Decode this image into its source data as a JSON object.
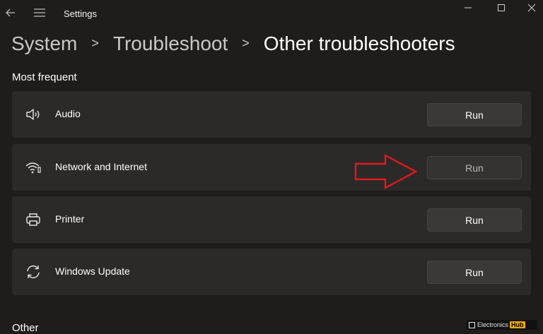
{
  "window": {
    "title": "Settings",
    "controls": [
      "minimize-icon",
      "maximize-icon",
      "close-icon"
    ]
  },
  "breadcrumb": {
    "items": [
      "System",
      "Troubleshoot",
      "Other troubleshooters"
    ],
    "separator": ">"
  },
  "sections": {
    "most_frequent": "Most frequent",
    "other": "Other"
  },
  "troubleshooters": [
    {
      "label": "Audio",
      "icon": "speaker-icon",
      "button": "Run"
    },
    {
      "label": "Network and Internet",
      "icon": "wifi-icon",
      "button": "Run"
    },
    {
      "label": "Printer",
      "icon": "printer-icon",
      "button": "Run"
    },
    {
      "label": "Windows Update",
      "icon": "sync-icon",
      "button": "Run"
    }
  ],
  "annotation": {
    "arrow_color": "#e0191e"
  },
  "watermark": {
    "text": "Electronics",
    "badge": "Hub"
  },
  "colors": {
    "background": "#1f1d1c",
    "card": "#2b2a29",
    "button": "#3a3938"
  }
}
